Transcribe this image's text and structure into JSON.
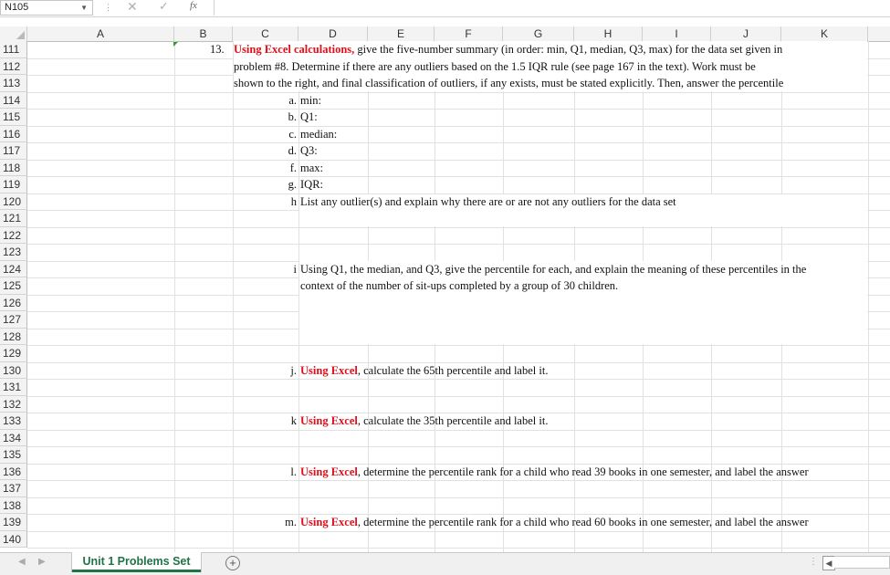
{
  "formula_bar": {
    "name_box": "N105",
    "cancel_icon": "✕",
    "enter_icon": "✓",
    "fx_label": "fx",
    "formula": ""
  },
  "columns": [
    "A",
    "B",
    "C",
    "D",
    "E",
    "F",
    "G",
    "H",
    "I",
    "J",
    "K"
  ],
  "rows": [
    "111",
    "112",
    "113",
    "114",
    "115",
    "116",
    "117",
    "118",
    "119",
    "120",
    "121",
    "122",
    "123",
    "124",
    "125",
    "126",
    "127",
    "128",
    "129",
    "130",
    "131",
    "132",
    "133",
    "134",
    "135",
    "136",
    "137",
    "138",
    "139",
    "140"
  ],
  "content": {
    "q_number": "13.",
    "q_red": "Using Excel calculations,",
    "q_line1_rest": " give the five-number summary (in order:  min, Q1, median, Q3, max) for the data set given in",
    "q_line2": "problem #8.  Determine if there are any outliers based on the 1.5 IQR  rule (see page 167 in the text).  Work must be",
    "q_line3": "shown to the right, and final classification of outliers, if any exists, must be stated explicitly.  Then, answer the percentile",
    "items": [
      {
        "label": "a.",
        "text": "min:"
      },
      {
        "label": "b.",
        "text": "Q1:"
      },
      {
        "label": "c.",
        "text": "median:"
      },
      {
        "label": "d.",
        "text": "Q3:"
      },
      {
        "label": "f.",
        "text": "max:"
      },
      {
        "label": "g.",
        "text": "IQR:"
      },
      {
        "label": "h",
        "text": "List any outlier(s) and explain why there are or are not any outliers for the data set"
      },
      {
        "label": "i",
        "text": "Using Q1, the median, and Q3, give the percentile for each, and explain the meaning of these percentiles in the"
      }
    ],
    "i_line2": "context of the number of sit-ups completed by a group of 30 children.",
    "excel_red": "Using Excel",
    "j_label": "j.",
    "j_rest": ", calculate the 65th percentile and label it.",
    "k_label": "k",
    "k_rest": ", calculate the 35th percentile and label it.",
    "l_label": "l.",
    "l_rest": ", determine the percentile rank for a child who read 39 books in one semester, and label the answer",
    "m_label": "m.",
    "m_rest": ", determine the percentile rank for a child who read 60 books in one semester, and label the answer"
  },
  "sheet_tabs": {
    "active": "Unit 1 Problems Set",
    "add_icon": "+",
    "prev_icon": "◀",
    "next_icon": "▶",
    "scroll_left_icon": "◀",
    "dots_icon": "⋮"
  }
}
